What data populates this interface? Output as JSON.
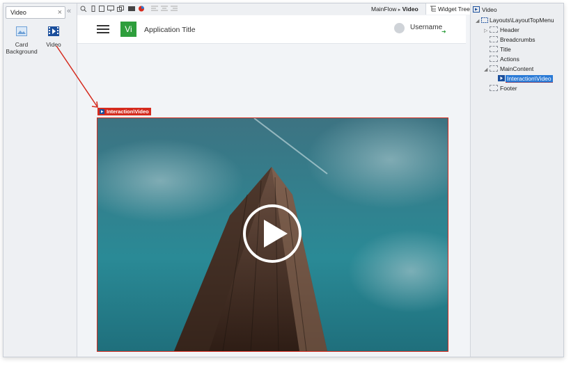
{
  "toolbox": {
    "search_value": "Video",
    "clear_glyph": "×",
    "collapse_glyph": "«",
    "tools": [
      {
        "label_line1": "Card",
        "label_line2": "Background",
        "icon": "image-icon"
      },
      {
        "label_line1": "Video",
        "label_line2": "",
        "icon": "video-icon"
      }
    ]
  },
  "topbar": {
    "breadcrumb_flow": "MainFlow",
    "breadcrumb_sep": "▸",
    "breadcrumb_screen": "Video",
    "widget_tree_tab": "Widget Tree"
  },
  "canvas": {
    "app_logo": "Vi",
    "app_title": "Application Title",
    "username": "Username",
    "selection_tag": "Interaction\\Video"
  },
  "tree": {
    "root": "Video",
    "layout": "Layouts\\LayoutTopMenu",
    "items": {
      "header": "Header",
      "breadcrumbs": "Breadcrumbs",
      "title": "Title",
      "actions": "Actions",
      "maincontent": "MainContent",
      "video": "Interaction\\Video",
      "footer": "Footer"
    }
  },
  "colors": {
    "accent_red": "#d52b1e",
    "logo_green": "#2e9e3c",
    "selection_blue": "#2a7ad6"
  }
}
